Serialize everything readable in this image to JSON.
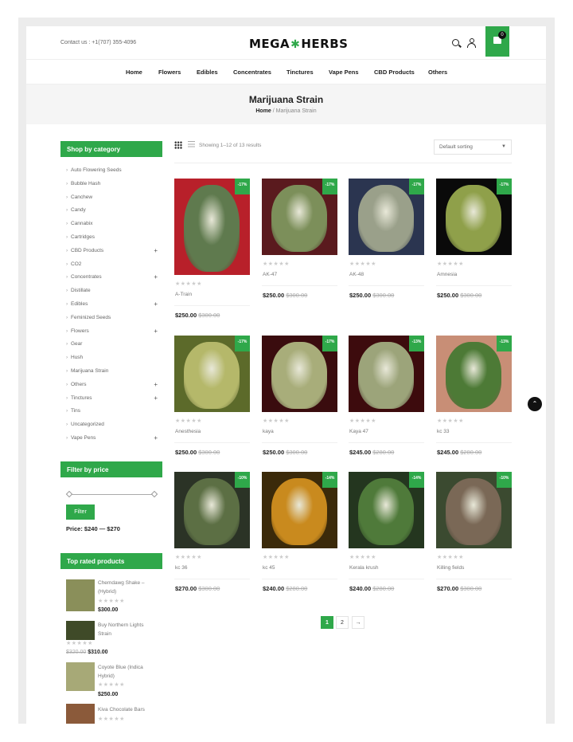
{
  "header": {
    "contact": "Contact us : +1(707) 355-4096",
    "logo_left": "MEGA",
    "logo_right": "HERBS",
    "cart_count": "0"
  },
  "nav": [
    "Home",
    "Flowers",
    "Edibles",
    "Concentrates",
    "Tinctures",
    "Vape Pens",
    "CBD Products",
    "Others"
  ],
  "banner": {
    "title": "Marijuana Strain",
    "crumb_home": "Home",
    "crumb_sep": " / ",
    "crumb_current": "Marijuana Strain"
  },
  "sidebar": {
    "categories_title": "Shop by category",
    "categories": [
      {
        "label": "Auto Flowering Seeds",
        "expandable": false
      },
      {
        "label": "Bubble Hash",
        "expandable": false
      },
      {
        "label": "Canchew",
        "expandable": false
      },
      {
        "label": "Candy",
        "expandable": false
      },
      {
        "label": "Cannabix",
        "expandable": false
      },
      {
        "label": "Cartridges",
        "expandable": false
      },
      {
        "label": "CBD Products",
        "expandable": true
      },
      {
        "label": "CO2",
        "expandable": false
      },
      {
        "label": "Concentrates",
        "expandable": true
      },
      {
        "label": "Distillate",
        "expandable": false
      },
      {
        "label": "Edibles",
        "expandable": true
      },
      {
        "label": "Feminized Seeds",
        "expandable": false
      },
      {
        "label": "Flowers",
        "expandable": true
      },
      {
        "label": "Gear",
        "expandable": false
      },
      {
        "label": "Hush",
        "expandable": false
      },
      {
        "label": "Marijuana Strain",
        "expandable": false
      },
      {
        "label": "Others",
        "expandable": true
      },
      {
        "label": "Tinctures",
        "expandable": true
      },
      {
        "label": "Tins",
        "expandable": false
      },
      {
        "label": "Uncategorized",
        "expandable": false
      },
      {
        "label": "Vape Pens",
        "expandable": true
      }
    ],
    "price_filter_title": "Filter by price",
    "filter_button": "Filter",
    "price_range": "Price: $240 — $270",
    "top_rated_title": "Top rated products",
    "top_rated": [
      {
        "name": "Chemdawg Shake – (Hybrid)",
        "old_price": "",
        "price": "$300.00"
      },
      {
        "name": "Buy Northern Lights Strain",
        "old_price": "$320.00",
        "price": "$310.00"
      },
      {
        "name": "Coyote Blue (Indica Hybrid)",
        "old_price": "",
        "price": "$250.00"
      },
      {
        "name": "Kiva Chocolate Bars",
        "old_price": "",
        "price": ""
      }
    ]
  },
  "toolbar": {
    "showing": "Showing 1–12 of 13 results",
    "sort_selected": "Default sorting"
  },
  "stars": "★★★★★",
  "products": [
    {
      "name": "A-Train",
      "badge": "-17%",
      "price": "$250.00",
      "old_price": "$300.00",
      "color": "#5f7a4e",
      "bg": "#b8202a"
    },
    {
      "name": "AK-47",
      "badge": "-17%",
      "price": "$250.00",
      "old_price": "$300.00",
      "color": "#7c8f5a",
      "bg": "#5a1a1e"
    },
    {
      "name": "AK-48",
      "badge": "-17%",
      "price": "$250.00",
      "old_price": "$300.00",
      "color": "#9aa08a",
      "bg": "#2b3550"
    },
    {
      "name": "Amnesia",
      "badge": "-17%",
      "price": "$250.00",
      "old_price": "$300.00",
      "color": "#8fa04a",
      "bg": "#0a0a0a"
    },
    {
      "name": "Anesthesia",
      "badge": "-17%",
      "price": "$250.00",
      "old_price": "$300.00",
      "color": "#b5b86a",
      "bg": "#5c6a2a"
    },
    {
      "name": "kaya",
      "badge": "-17%",
      "price": "$250.00",
      "old_price": "$300.00",
      "color": "#a8ad7a",
      "bg": "#3a0c0e"
    },
    {
      "name": "Kaya 47",
      "badge": "-13%",
      "price": "$245.00",
      "old_price": "$280.00",
      "color": "#9ca47a",
      "bg": "#3d0b0d"
    },
    {
      "name": "kc 33",
      "badge": "-13%",
      "price": "$245.00",
      "old_price": "$280.00",
      "color": "#4d7a36",
      "bg": "#c88e76"
    },
    {
      "name": "kc 36",
      "badge": "-10%",
      "price": "$270.00",
      "old_price": "$300.00",
      "color": "#5c6f44",
      "bg": "#2b3326"
    },
    {
      "name": "kc 45",
      "badge": "-14%",
      "price": "$240.00",
      "old_price": "$280.00",
      "color": "#c98a1e",
      "bg": "#3b2a0a"
    },
    {
      "name": "Kerala krush",
      "badge": "-14%",
      "price": "$240.00",
      "old_price": "$280.00",
      "color": "#4f7a3a",
      "bg": "#24361f"
    },
    {
      "name": "Killing fields",
      "badge": "-10%",
      "price": "$270.00",
      "old_price": "$300.00",
      "color": "#7a6856",
      "bg": "#3b4a30"
    }
  ],
  "pagination": [
    "1",
    "2",
    "→"
  ],
  "back_to_top": "⌃",
  "accent": "#2fa84a"
}
